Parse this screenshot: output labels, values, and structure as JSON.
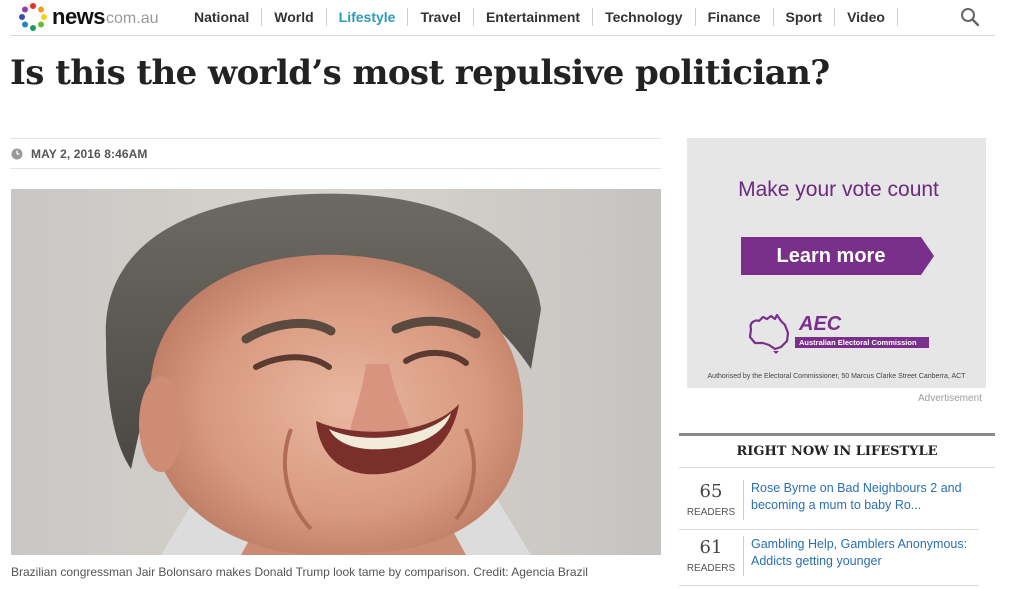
{
  "site": {
    "logo_main": "news",
    "logo_domain": "com.au"
  },
  "nav": {
    "items": [
      {
        "label": "National"
      },
      {
        "label": "World"
      },
      {
        "label": "Lifestyle",
        "active": true
      },
      {
        "label": "Travel"
      },
      {
        "label": "Entertainment"
      },
      {
        "label": "Technology"
      },
      {
        "label": "Finance"
      },
      {
        "label": "Sport"
      },
      {
        "label": "Video"
      }
    ],
    "search_icon": "search-icon"
  },
  "article": {
    "headline": "Is this the world’s most repulsive politician?",
    "date": "MAY 2, 2016  8:46AM",
    "caption": "Brazilian congressman Jair Bolonsaro makes Donald Trump look tame by comparison. Credit: Agencia Brazil"
  },
  "ad": {
    "title": "Make your vote count",
    "cta": "Learn more",
    "org_short": "AEC",
    "org_name": "Australian Electoral Commission",
    "authorised": "Authorised by the Electoral Commissioner, 50 Marcus Clarke Street Canberra, ACT",
    "label": "Advertisement"
  },
  "right_now": {
    "heading": "RIGHT NOW IN LIFESTYLE",
    "items": [
      {
        "count": "65",
        "readers_label": "READERS",
        "title": "Rose Byrne on Bad Neighbours 2 and becoming a mum to baby Ro..."
      },
      {
        "count": "61",
        "readers_label": "READERS",
        "title": "Gambling Help, Gamblers Anonymous: Addicts getting younger"
      }
    ]
  },
  "colors": {
    "nav_active": "#2a9bbd",
    "ad_purple": "#6b2a7e",
    "link_blue": "#2a6fb3"
  }
}
